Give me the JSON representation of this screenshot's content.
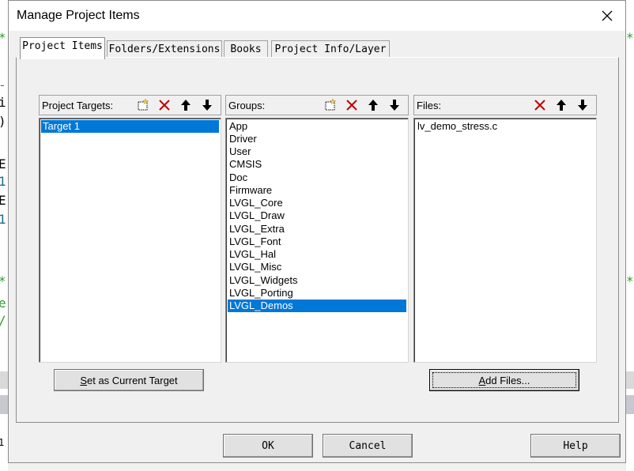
{
  "window": {
    "title": "Manage Project Items"
  },
  "tabs": [
    {
      "label": "Project Items",
      "active": true
    },
    {
      "label": "Folders/Extensions",
      "active": false
    },
    {
      "label": "Books",
      "active": false
    },
    {
      "label": "Project Info/Layer",
      "active": false
    }
  ],
  "targets": {
    "label": "Project Targets:",
    "items": [
      "Target 1"
    ],
    "selected_index": 0
  },
  "groups": {
    "label": "Groups:",
    "items": [
      "App",
      "Driver",
      "User",
      "CMSIS",
      "Doc",
      "Firmware",
      "LVGL_Core",
      "LVGL_Draw",
      "LVGL_Extra",
      "LVGL_Font",
      "LVGL_Hal",
      "LVGL_Misc",
      "LVGL_Widgets",
      "LVGL_Porting",
      "LVGL_Demos"
    ],
    "selected_index": 14
  },
  "files": {
    "label": "Files:",
    "items": [
      "lv_demo_stress.c"
    ]
  },
  "buttons": {
    "set_target_mnemonic": "S",
    "set_target_rest": "et as Current Target",
    "add_files_mnemonic": "A",
    "add_files_rest": "dd Files...",
    "ok": "OK",
    "cancel": "Cancel",
    "help": "Help"
  },
  "background_fragments": {
    "left": [
      "i",
      ")",
      "E",
      "1",
      "E",
      "1",
      "e"
    ],
    "left_bottom": "1"
  },
  "colors": {
    "selection": "#0078d7",
    "delete_red": "#c00000",
    "new_yellow": "#f5d76e"
  }
}
